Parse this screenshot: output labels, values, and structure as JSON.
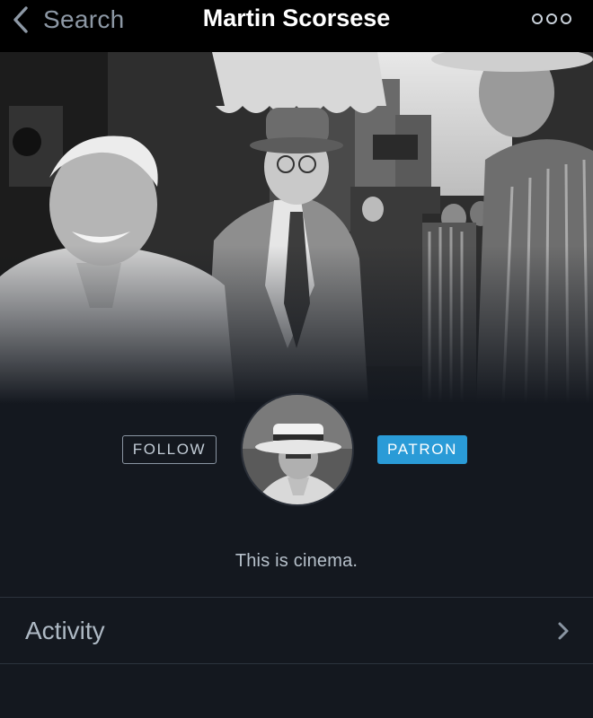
{
  "nav": {
    "back_label": "Search",
    "title": "Martin Scorsese",
    "more_icon": "more-dots-icon",
    "back_icon": "chevron-left-icon"
  },
  "profile": {
    "follow_label": "FOLLOW",
    "patron_label": "PATRON",
    "bio": "This is cinema."
  },
  "menu": {
    "activity_label": "Activity",
    "activity_icon": "chevron-right-icon"
  },
  "colors": {
    "background": "#14181f",
    "topbar": "#000000",
    "patron_badge": "#2a9bd7",
    "text_muted": "#9aa5b1"
  }
}
